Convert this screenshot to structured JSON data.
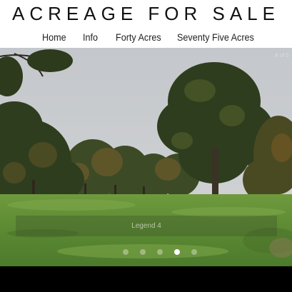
{
  "site": {
    "title": "ACREAGE FOR SALE"
  },
  "nav": {
    "items": [
      {
        "label": "Home"
      },
      {
        "label": "Info"
      },
      {
        "label": "Forty Acres"
      },
      {
        "label": "Seventy Five Acres"
      }
    ]
  },
  "slider": {
    "counter": "4 of 5",
    "caption": "Legend 4",
    "total_slides": 5,
    "active_slide": 4
  },
  "colors": {
    "header_bg": "#ffffff",
    "footer_bg": "#000000",
    "grass": "#5b8a33",
    "sky": "#c9ccd0",
    "active_dot": "#ffffff"
  }
}
